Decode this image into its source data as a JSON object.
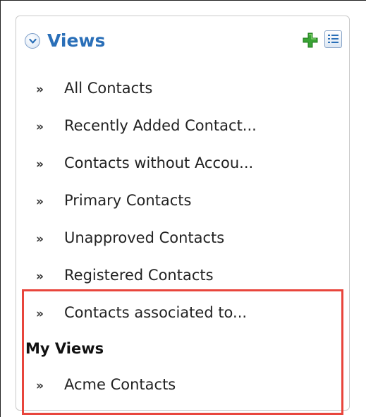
{
  "views_panel": {
    "title": "Views",
    "icons": {
      "collapse": "chevron-down-circle-icon",
      "add": "green-plus-icon",
      "list": "list-icon"
    },
    "items": [
      {
        "label": "All Contacts"
      },
      {
        "label": "Recently Added Contact..."
      },
      {
        "label": "Contacts without Accou..."
      },
      {
        "label": "Primary Contacts"
      },
      {
        "label": "Unapproved Contacts"
      },
      {
        "label": "Registered Contacts"
      },
      {
        "label": "Contacts associated to..."
      }
    ],
    "my_views": {
      "title": "My Views",
      "items": [
        {
          "label": "Acme Contacts"
        }
      ]
    },
    "bullet_glyph": "»"
  },
  "colors": {
    "title": "#2a6fb8",
    "highlight": "#e8453c",
    "add_icon": "#3aa335"
  }
}
